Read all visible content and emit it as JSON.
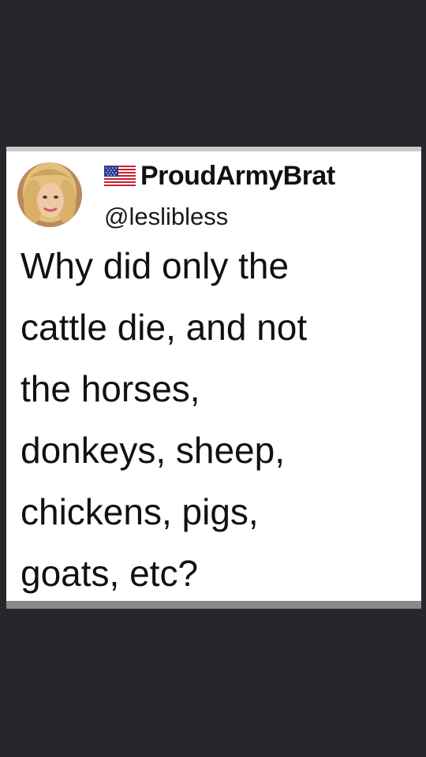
{
  "tweet": {
    "display_name": "ProudArmyBrat",
    "handle": "@leslibless",
    "flag_icon": "us-flag-icon",
    "avatar_icon": "profile-photo",
    "body_lines": [
      "Why did only the",
      "cattle die, and not",
      "the horses,",
      "donkeys, sheep,",
      "chickens, pigs,",
      "goats, etc?"
    ]
  },
  "colors": {
    "background": "#25272c",
    "card": "#ffffff",
    "text": "#111111"
  }
}
